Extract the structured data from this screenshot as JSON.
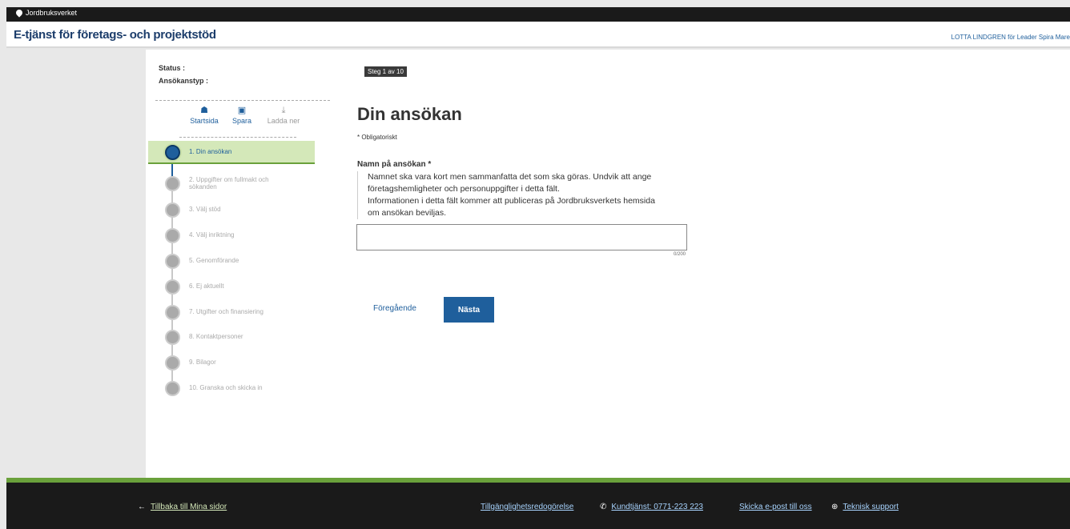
{
  "topbar": {
    "logo_text": "Jordbruksverket"
  },
  "header": {
    "title": "E-tjänst för företags- och projektstöd",
    "user": "LOTTA LINDGREN för Leader Spira Mare"
  },
  "sidebar": {
    "status_label": "Status :",
    "type_label": "Ansökanstyp :",
    "tools": [
      {
        "label": "Startsida",
        "icon": "home-icon"
      },
      {
        "label": "Spara",
        "icon": "save-icon"
      },
      {
        "label": "Ladda ner",
        "icon": "download-icon"
      }
    ],
    "steps": [
      {
        "label": "1. Din ansökan"
      },
      {
        "label": "2. Uppgifter om fullmakt och sökanden"
      },
      {
        "label": "3. Välj stöd"
      },
      {
        "label": "4. Välj inriktning"
      },
      {
        "label": "5. Genomförande"
      },
      {
        "label": "6. Ej aktuellt"
      },
      {
        "label": "7. Utgifter och finansiering"
      },
      {
        "label": "8. Kontaktpersoner"
      },
      {
        "label": "9. Bilagor"
      },
      {
        "label": "10. Granska och skicka in"
      }
    ]
  },
  "main": {
    "step_badge": "Steg 1 av 10",
    "heading": "Din ansökan",
    "required_note": "* Obligatoriskt",
    "field_label": "Namn på ansökan *",
    "help": [
      "Namnet ska vara kort men sammanfatta det som ska göras. Undvik att ange",
      "företagshemligheter och personuppgifter i detta fält.",
      "Informationen i detta fält kommer att publiceras på Jordbruksverkets hemsida",
      "om ansökan beviljas."
    ],
    "input_value": "",
    "counter": "0/200",
    "prev_label": "Föregående",
    "next_label": "Nästa"
  },
  "footer": {
    "back": "Tillbaka till Mina sidor",
    "accessibility": "Tillgänglighetsredogörelse",
    "phone": "Kundtjänst: 0771-223 223",
    "email": "Skicka e-post till oss",
    "support": "Teknisk support"
  },
  "colors": {
    "accent": "#1f5f9c",
    "green": "#6aa13b",
    "dark": "#1a1a1a"
  }
}
